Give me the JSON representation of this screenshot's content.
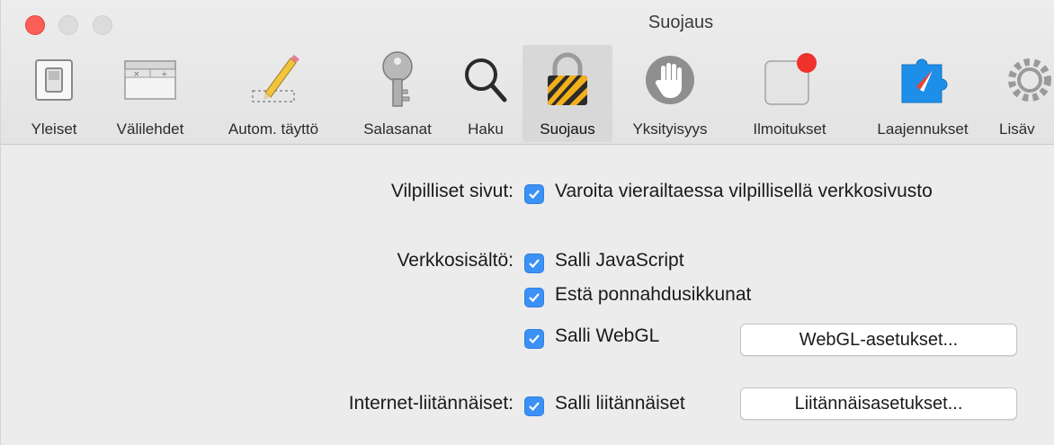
{
  "window": {
    "title": "Suojaus"
  },
  "toolbar": {
    "items": [
      {
        "label": "Yleiset",
        "icon": "switch-icon"
      },
      {
        "label": "Välilehdet",
        "icon": "tabs-icon"
      },
      {
        "label": "Autom. täyttö",
        "icon": "pencil-icon"
      },
      {
        "label": "Salasanat",
        "icon": "key-icon"
      },
      {
        "label": "Haku",
        "icon": "magnifier-icon"
      },
      {
        "label": "Suojaus",
        "icon": "lock-icon"
      },
      {
        "label": "Yksityisyys",
        "icon": "hand-icon"
      },
      {
        "label": "Ilmoitukset",
        "icon": "notification-icon"
      },
      {
        "label": "Laajennukset",
        "icon": "puzzle-icon"
      },
      {
        "label": "Lisäv",
        "icon": "gear-icon"
      }
    ],
    "selected": "Suojaus"
  },
  "settings": {
    "fraud": {
      "label": "Vilpilliset sivut:",
      "option": "Varoita vierailtaessa vilpillisellä verkkosivusto",
      "checked": true
    },
    "web_content": {
      "label": "Verkkosisältö:",
      "options": [
        {
          "label": "Salli JavaScript",
          "checked": true
        },
        {
          "label": "Estä ponnahdusikkunat",
          "checked": true
        },
        {
          "label": "Salli WebGL",
          "checked": true
        }
      ],
      "webgl_button": "WebGL-asetukset..."
    },
    "plugins": {
      "label": "Internet-liitännäiset:",
      "option": "Salli liitännäiset",
      "checked": true,
      "button": "Liitännäisasetukset..."
    }
  },
  "colors": {
    "accent": "#3b91f5",
    "close": "#fc5f57",
    "notification_dot": "#f0312c"
  }
}
